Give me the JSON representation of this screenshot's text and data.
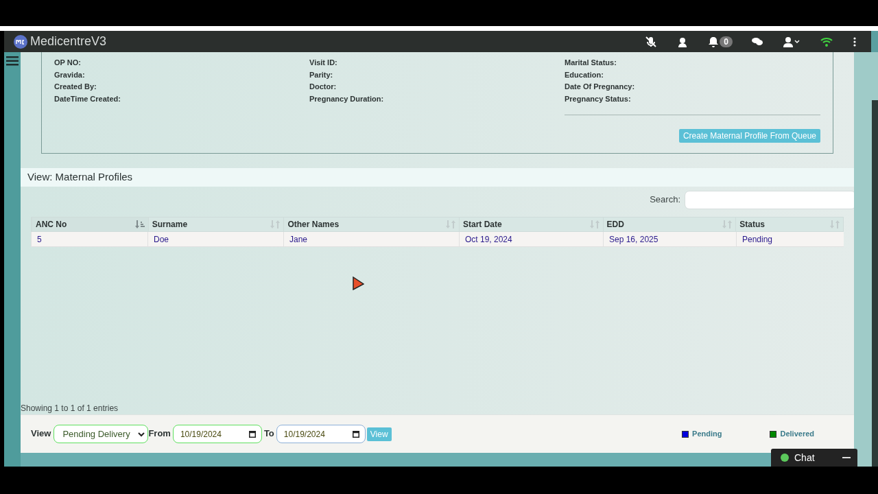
{
  "app": {
    "title": "MedicentreV3",
    "notification_count": "0",
    "wifi_connected": true
  },
  "profile": {
    "columns": [
      [
        "OP NO:",
        "Gravida:",
        "Created By:",
        "DateTime Created:"
      ],
      [
        "Visit ID:",
        "Parity:",
        "Doctor:",
        "Pregnancy Duration:"
      ],
      [
        "Marital Status:",
        "Education:",
        "Date Of Pregnancy:",
        "Pregnancy Status:"
      ]
    ],
    "create_button": "Create Maternal Profile From Queue"
  },
  "section_title": "View: Maternal Profiles",
  "search": {
    "label": "Search:"
  },
  "table": {
    "columns": [
      {
        "label": "ANC No",
        "sorted": true
      },
      {
        "label": "Surname",
        "sorted": false
      },
      {
        "label": "Other Names",
        "sorted": false
      },
      {
        "label": "Start Date",
        "sorted": false
      },
      {
        "label": "EDD",
        "sorted": false
      },
      {
        "label": "Status",
        "sorted": false
      }
    ],
    "rows": [
      [
        "5",
        "Doe",
        "Jane",
        "Oct 19, 2024",
        "Sep 16, 2025",
        "Pending"
      ]
    ]
  },
  "info": "Showing 1 to 1 of 1 entries",
  "filter": {
    "view_label": "View",
    "view_value": "Pending Delivery",
    "from_label": "From",
    "from_date": "10/19/2024",
    "to_label": "To",
    "to_date": "10/19/2024",
    "button": "View"
  },
  "legend": [
    {
      "label": "Pending",
      "color": "#0000dd"
    },
    {
      "label": "Delivered",
      "color": "#008800"
    }
  ],
  "chat": {
    "label": "Chat",
    "online": true
  }
}
